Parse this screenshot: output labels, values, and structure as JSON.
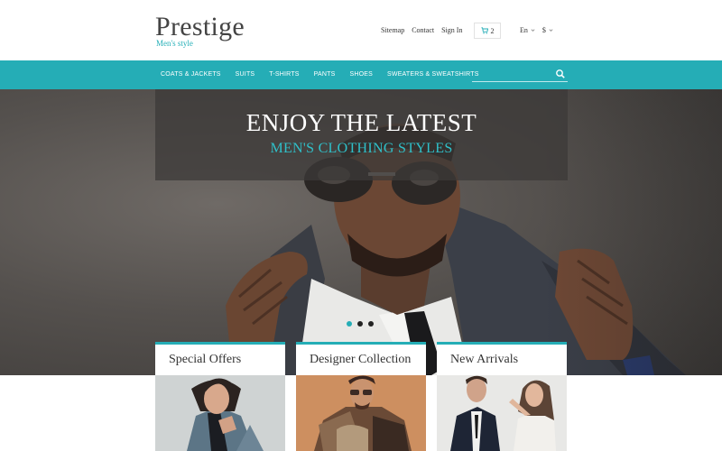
{
  "brand": {
    "name": "Prestige",
    "tagline": "Men's style"
  },
  "top_links": [
    "Sitemap",
    "Contact",
    "Sign In"
  ],
  "cart": {
    "count": "2"
  },
  "selectors": {
    "language": "En",
    "currency": "$"
  },
  "nav": {
    "items": [
      "COATS & JACKETS",
      "SUITS",
      "T-SHIRTS",
      "PANTS",
      "SHOES",
      "SWEATERS & SWEATSHIRTS"
    ]
  },
  "search": {
    "placeholder": ""
  },
  "hero": {
    "title": "ENJOY THE LATEST",
    "subtitle": "MEN'S CLOTHING STYLES",
    "slides": 3,
    "active_slide": 1
  },
  "cards": [
    {
      "title": "Special Offers"
    },
    {
      "title": "Designer Collection"
    },
    {
      "title": "New Arrivals"
    }
  ],
  "colors": {
    "accent": "#25adb6",
    "text": "#333333",
    "logo": "#444444"
  },
  "icons": {
    "cart": "cart-icon",
    "search": "search-icon",
    "chevron": "chevron-down-icon"
  }
}
